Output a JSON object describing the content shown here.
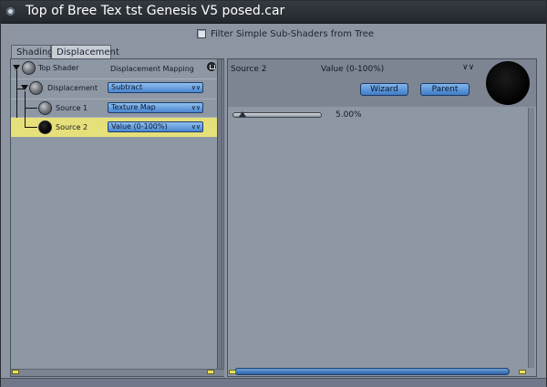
{
  "window": {
    "title": "Top of Bree Tex tst Genesis V5 posed.car"
  },
  "filter": {
    "label": "Filter Simple Sub-Shaders from Tree",
    "checked": false
  },
  "tabs": [
    {
      "label": "Shading",
      "active": false
    },
    {
      "label": "Displacement",
      "active": true
    }
  ],
  "tree": {
    "rows": [
      {
        "label": "Top Shader",
        "right_label": "Displacement Mapping",
        "dropdown": ""
      },
      {
        "label": "Displacement",
        "dropdown": "Subtract"
      },
      {
        "label": "Source 1",
        "dropdown": "Texture Map"
      },
      {
        "label": "Source 2",
        "dropdown": "Value (0-100%)",
        "selected": true
      }
    ]
  },
  "detail": {
    "name": "Source 2",
    "type_label": "Value (0-100%)",
    "wizard_label": "Wizard",
    "parent_label": "Parent",
    "slider_value_text": "5.00%",
    "slider_value": 5
  },
  "colors": {
    "selected_row": "#e6e07a",
    "accent_blue": "#4a86cf"
  },
  "icons": [
    "close-icon",
    "checkbox-icon",
    "trash-icon",
    "chevron-down-icon",
    "expand-triangle-icon",
    "sphere-preview-icon"
  ]
}
